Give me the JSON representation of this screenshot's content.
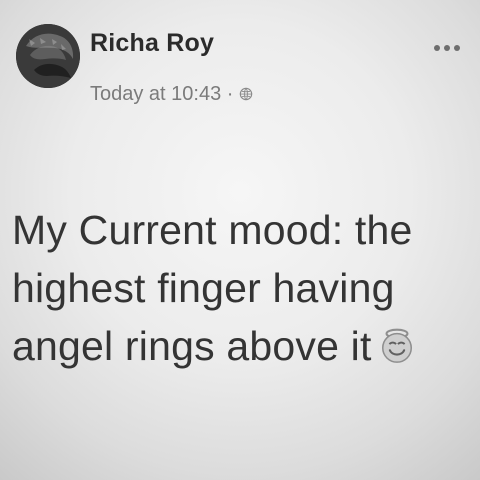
{
  "post": {
    "author": "Richa Roy",
    "timestamp": "Today at 10:43 ·",
    "text": "My Current mood: the highest finger having angel rings above it",
    "emoji_name": "smiling-face-with-halo-icon"
  },
  "icons": {
    "audience": "globe-icon",
    "more": "more-options-icon"
  }
}
